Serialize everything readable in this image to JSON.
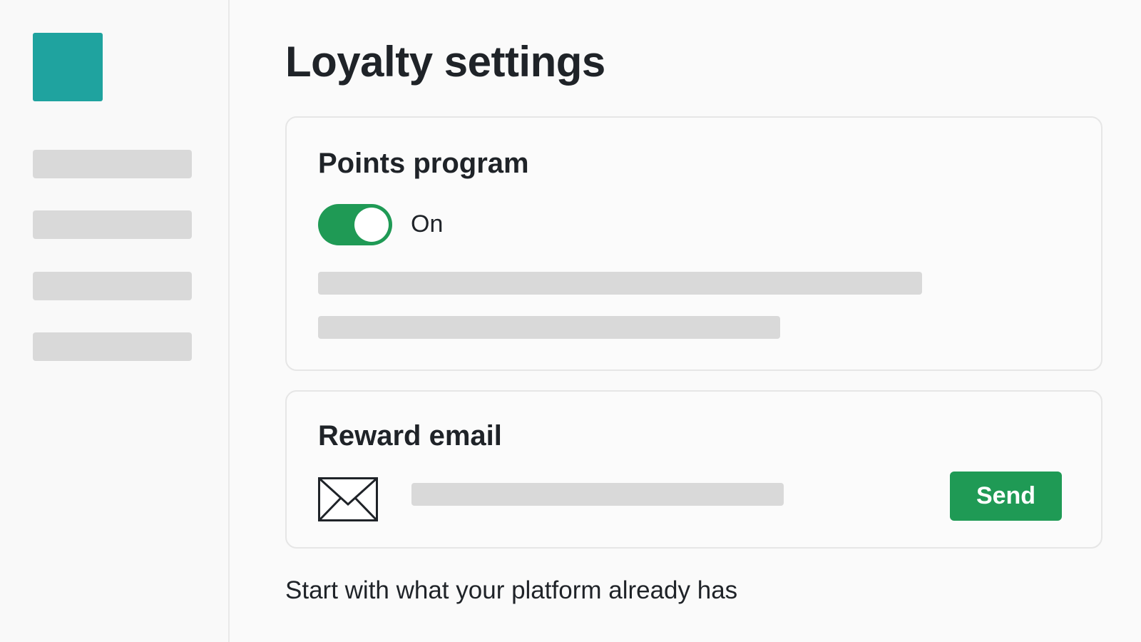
{
  "colors": {
    "logo": "#1fa39f",
    "toggle_on": "#1f9a55",
    "send_button": "#1f9a55"
  },
  "sidebar": {
    "items": [
      {
        "label": ""
      },
      {
        "label": ""
      },
      {
        "label": ""
      },
      {
        "label": ""
      }
    ]
  },
  "page": {
    "title": "Loyalty settings"
  },
  "points_program": {
    "title": "Points program",
    "toggle_state": "On",
    "toggle_on": true
  },
  "reward_email": {
    "title": "Reward email",
    "icon": "envelope-icon",
    "send_label": "Send"
  },
  "footer": {
    "text": "Start with what your platform already has"
  }
}
